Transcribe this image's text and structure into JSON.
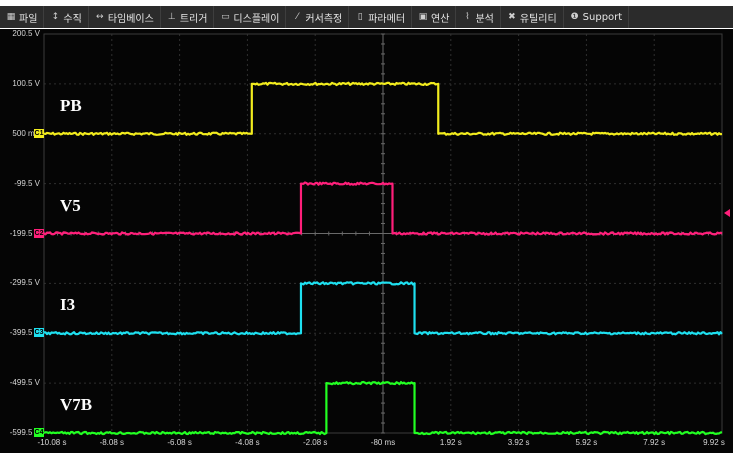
{
  "menu": [
    {
      "icon": "file-icon",
      "glyph": "▦",
      "label": "파일"
    },
    {
      "icon": "vertical-icon",
      "glyph": "↕",
      "label": "수직"
    },
    {
      "icon": "timebase-icon",
      "glyph": "↔",
      "label": "타임베이스"
    },
    {
      "icon": "trigger-icon",
      "glyph": "⊥",
      "label": "트리거"
    },
    {
      "icon": "display-icon",
      "glyph": "▭",
      "label": "디스플레이"
    },
    {
      "icon": "cursor-icon",
      "glyph": "⁄",
      "label": "커서측정"
    },
    {
      "icon": "parameter-icon",
      "glyph": "▯",
      "label": "파라메터"
    },
    {
      "icon": "math-icon",
      "glyph": "▣",
      "label": "연산"
    },
    {
      "icon": "analysis-icon",
      "glyph": "⌇",
      "label": "분석"
    },
    {
      "icon": "utility-icon",
      "glyph": "✖",
      "label": "유틸리티"
    },
    {
      "icon": "support-icon",
      "glyph": "❶",
      "label": "Support"
    }
  ],
  "y_labels": [
    "200.5 V",
    "100.5 V",
    "500 mV",
    "-99.5 V",
    "-199.5 V",
    "-299.5 V",
    "-399.5 V",
    "-499.5 V",
    "-599.5 V"
  ],
  "x_labels": [
    "-10.08 s",
    "-8.08 s",
    "-6.08 s",
    "-4.08 s",
    "-2.08 s",
    "-80 ms",
    "1.92 s",
    "3.92 s",
    "5.92 s",
    "7.92 s",
    "9.92 s"
  ],
  "channels": [
    {
      "name": "PB",
      "marker": "C1",
      "color": "#f2ec1e",
      "baseline": "500 mV",
      "high": "100.5 V",
      "rise": "-3.95 s",
      "fall": "1.55 s"
    },
    {
      "name": "V5",
      "marker": "C2",
      "color": "#ff1f7a",
      "baseline": "-199.5 V",
      "high": "-99.5 V",
      "rise": "-2.5 s",
      "fall": "0.2 s"
    },
    {
      "name": "I3",
      "marker": "C3",
      "color": "#1ee0f0",
      "baseline": "-399.5 V",
      "high": "-299.5 V",
      "rise": "-2.5 s",
      "fall": "0.85 s"
    },
    {
      "name": "V7B",
      "marker": "C4",
      "color": "#22ff22",
      "baseline": "-599.5 V",
      "high": "-499.5 V",
      "rise": "-1.75 s",
      "fall": "0.85 s"
    }
  ],
  "colors": {
    "background": "#050505",
    "grid": "#2f2f2f",
    "axis": "#6a6a6a",
    "menubar": "#2b2b2b"
  }
}
